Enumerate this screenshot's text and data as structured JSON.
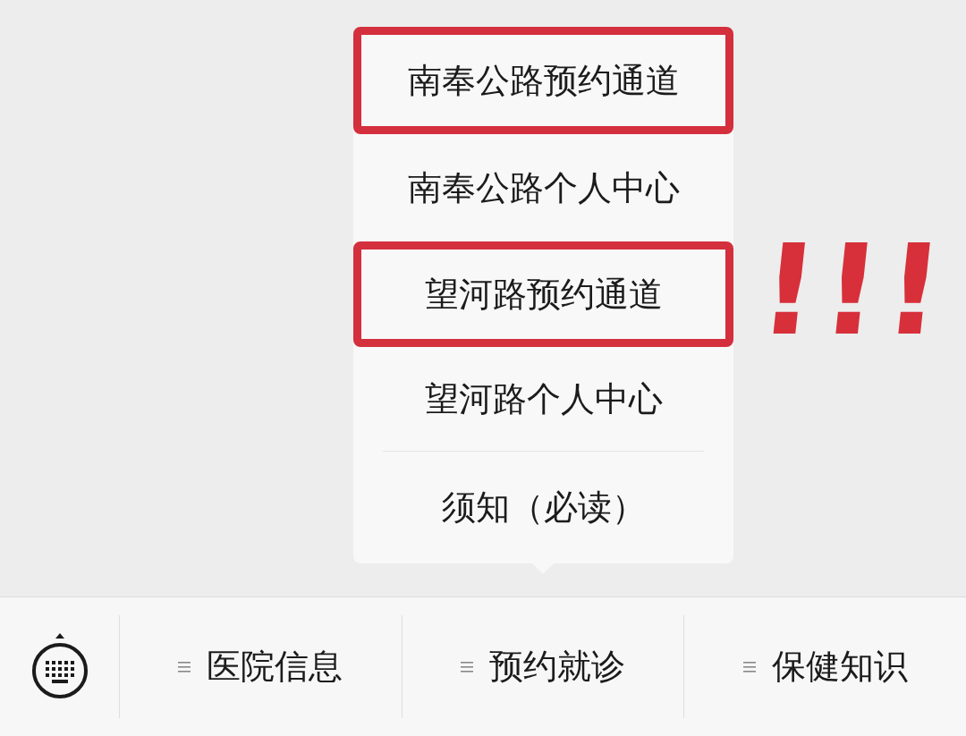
{
  "menu": {
    "items": [
      {
        "label": "南奉公路预约通道",
        "highlighted": true
      },
      {
        "label": "南奉公路个人中心",
        "highlighted": false
      },
      {
        "label": "望河路预约通道",
        "highlighted": true
      },
      {
        "label": "望河路个人中心",
        "highlighted": false
      },
      {
        "label": "须知（必读）",
        "highlighted": false
      }
    ]
  },
  "annotation": {
    "text": "!!!"
  },
  "bottom_bar": {
    "tabs": [
      {
        "label": "医院信息"
      },
      {
        "label": "预约就诊"
      },
      {
        "label": "保健知识"
      }
    ]
  }
}
